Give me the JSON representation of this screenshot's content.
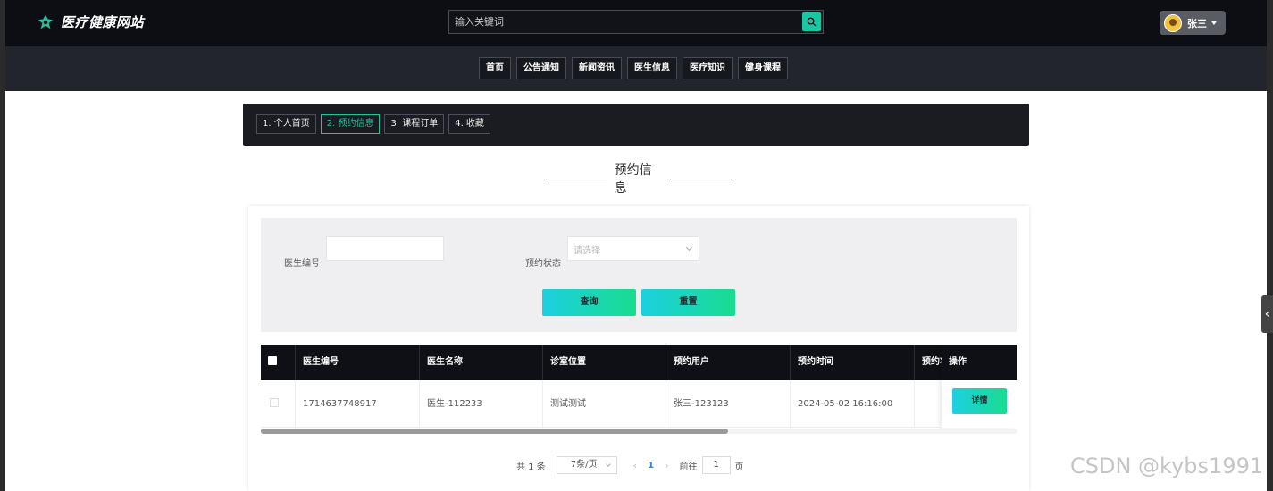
{
  "header": {
    "site_title": "医疗健康网站",
    "search_placeholder": "输入关键词",
    "user_name": "张三"
  },
  "nav": {
    "items": [
      "首页",
      "公告通知",
      "新闻资讯",
      "医生信息",
      "医疗知识",
      "健身课程"
    ]
  },
  "tabs": {
    "items": [
      "1. 个人首页",
      "2. 预约信息",
      "3. 课程订单",
      "4. 收藏"
    ],
    "active_index": 1
  },
  "section_title": "预约信息",
  "filter": {
    "doctor_no_label": "医生编号",
    "doctor_no_value": "",
    "status_label": "预约状态",
    "status_placeholder": "请选择",
    "query_button": "查询",
    "reset_button": "重置"
  },
  "table": {
    "columns": [
      "医生编号",
      "医生名称",
      "诊室位置",
      "预约用户",
      "预约时间",
      "预约状",
      "操作"
    ],
    "rows": [
      {
        "doctor_no": "1714637748917",
        "doctor_name": "医生-112233",
        "room": "测试测试",
        "user": "张三-123123",
        "time": "2024-05-02 16:16:00",
        "status": "",
        "action": "详情"
      }
    ]
  },
  "pagination": {
    "total": "共 1 条",
    "page_size": "7条/页",
    "prev": "‹",
    "current": "1",
    "next": "›",
    "goto_label": "前往",
    "goto_value": "1",
    "page_unit": "页"
  },
  "watermark": "CSDN @kybs1991",
  "colors": {
    "accent": "#1bc6a1",
    "header_bg": "#0d0e13",
    "nav_bg": "#22252b",
    "gradient_start": "#1cd0e0",
    "gradient_end": "#19dc8f"
  }
}
